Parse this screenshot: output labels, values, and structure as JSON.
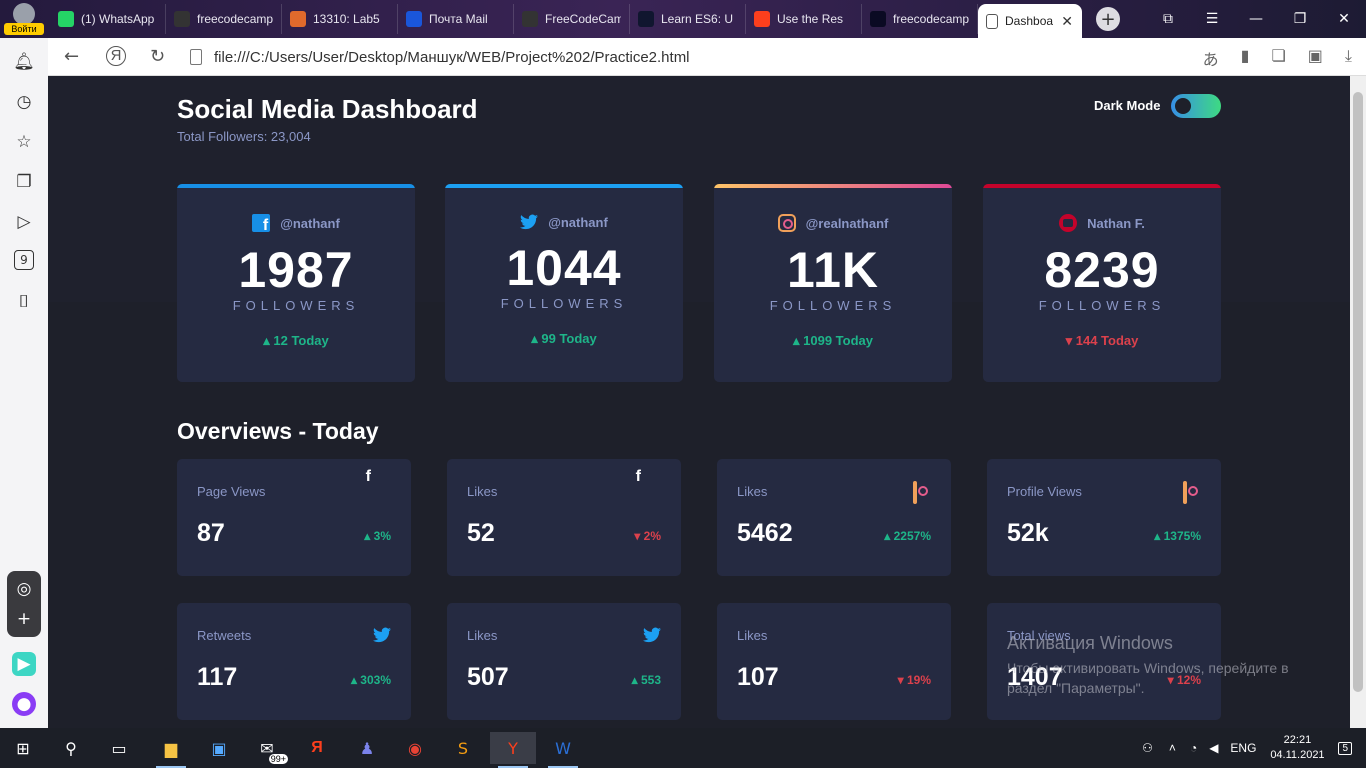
{
  "browser": {
    "profile_label": "Войти",
    "tabs": [
      {
        "label": "(1) WhatsApp",
        "icon": "whatsapp-icon",
        "color": "#25d366"
      },
      {
        "label": "freecodecamp",
        "icon": "github-icon",
        "color": "#333333"
      },
      {
        "label": "13310: Lab5",
        "icon": "labs-icon",
        "color": "#e06a2c"
      },
      {
        "label": "Почта Mail",
        "icon": "mail-icon",
        "color": "#1a56db"
      },
      {
        "label": "FreeCodeCamp",
        "icon": "github-icon",
        "color": "#333333"
      },
      {
        "label": "Learn ES6: U",
        "icon": "code-icon",
        "color": "#10162f"
      },
      {
        "label": "Use the Res",
        "icon": "yandex-icon",
        "color": "#fc3f1d"
      },
      {
        "label": "freecodecamp",
        "icon": "fcc-icon",
        "color": "#0a0a23"
      }
    ],
    "active_tab": "Dashboa",
    "address": "file:///C:/Users/User/Desktop/Маншук/WEB/Project%202/Practice2.html"
  },
  "header": {
    "title": "Social Media Dashboard",
    "total_followers": "Total Followers: 23,004",
    "dark_mode_label": "Dark Mode"
  },
  "cards": [
    {
      "handle": "@nathanf",
      "icon": "facebook-icon",
      "count": "1987",
      "label": "FOLLOWERS",
      "today": "12 Today",
      "trend": "up",
      "bar": "#178fe6"
    },
    {
      "handle": "@nathanf",
      "icon": "twitter-icon",
      "count": "1044",
      "label": "FOLLOWERS",
      "today": "99 Today",
      "trend": "up",
      "bar": "#1ca0f2"
    },
    {
      "handle": "@realnathanf",
      "icon": "instagram-icon",
      "count": "11K",
      "label": "FOLLOWERS",
      "today": "1099 Today",
      "trend": "up",
      "bar": "linear-gradient(90deg,#fdc468,#df4996)"
    },
    {
      "handle": "Nathan F.",
      "icon": "youtube-icon",
      "count": "8239",
      "label": "FOLLOWERS",
      "today": "144 Today",
      "trend": "down",
      "bar": "#c4032b"
    }
  ],
  "overview_title": "Overviews - Today",
  "overviews": [
    {
      "label": "Page Views",
      "icon": "facebook-icon",
      "value": "87",
      "pct": "3%",
      "trend": "up"
    },
    {
      "label": "Likes",
      "icon": "facebook-icon",
      "value": "52",
      "pct": "2%",
      "trend": "down"
    },
    {
      "label": "Likes",
      "icon": "instagram-icon",
      "value": "5462",
      "pct": "2257%",
      "trend": "up"
    },
    {
      "label": "Profile Views",
      "icon": "instagram-icon",
      "value": "52k",
      "pct": "1375%",
      "trend": "up"
    },
    {
      "label": "Retweets",
      "icon": "twitter-icon",
      "value": "117",
      "pct": "303%",
      "trend": "up"
    },
    {
      "label": "Likes",
      "icon": "twitter-icon",
      "value": "507",
      "pct": "553",
      "trend": "up"
    },
    {
      "label": "Likes",
      "icon": "youtube-icon",
      "value": "107",
      "pct": "19%",
      "trend": "down"
    },
    {
      "label": "Total views",
      "icon": "youtube-icon",
      "value": "1407",
      "pct": "12%",
      "trend": "down"
    }
  ],
  "watermark": {
    "title": "Активация Windows",
    "text": "Чтобы активировать Windows, перейдите в раздел \"Параметры\"."
  },
  "taskbar": {
    "lang": "ENG",
    "time": "22:21",
    "date": "04.11.2021",
    "notif_count": "5",
    "badge": "99+"
  },
  "sidebar": {
    "counter": "9"
  },
  "colors": {
    "up": "#1eb589",
    "down": "#dc414c",
    "card_bg": "#252a41",
    "page_bg": "#1e202a"
  }
}
